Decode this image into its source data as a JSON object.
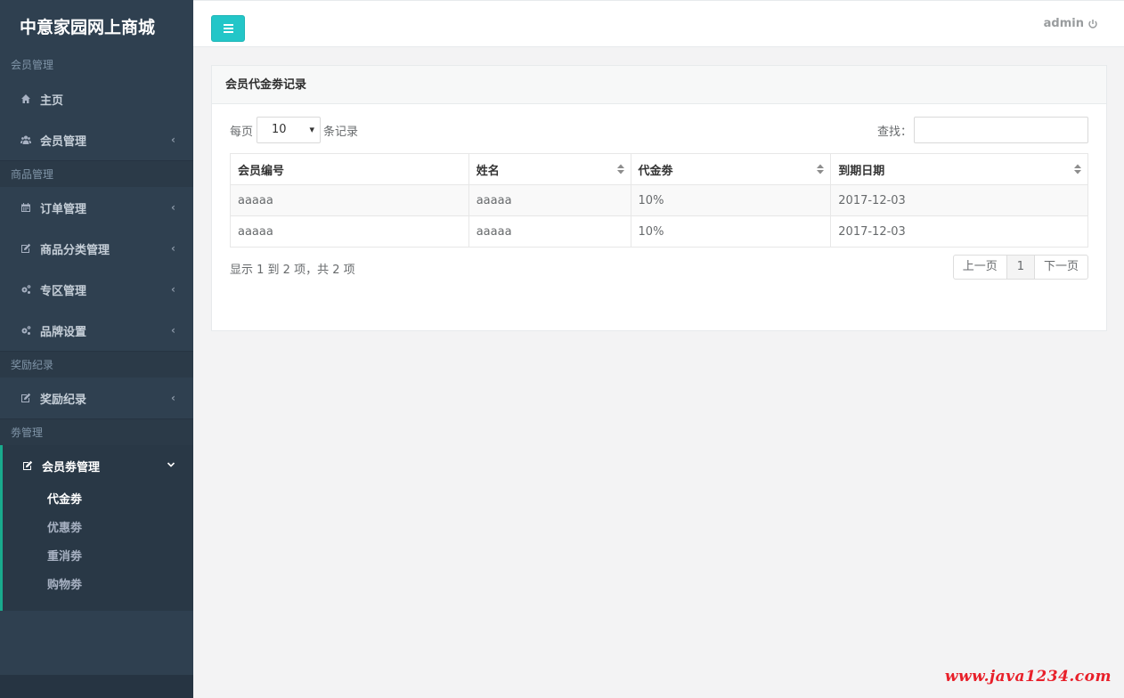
{
  "app": {
    "title": "中意家园网上商城"
  },
  "sidebar": {
    "sections": [
      {
        "label": "会员管理"
      },
      {
        "label": "商品管理"
      },
      {
        "label": "奖励纪录"
      },
      {
        "label": "劵管理"
      }
    ],
    "items": [
      {
        "label": "主页",
        "icon": "home-icon"
      },
      {
        "label": "会员管理",
        "icon": "users-icon"
      },
      {
        "label": "订单管理",
        "icon": "calendar-icon"
      },
      {
        "label": "商品分类管理",
        "icon": "edit-icon"
      },
      {
        "label": "专区管理",
        "icon": "cogs-icon"
      },
      {
        "label": "品牌设置",
        "icon": "cogs-icon"
      },
      {
        "label": "奖励纪录",
        "icon": "edit-icon"
      },
      {
        "label": "会员劵管理",
        "icon": "edit-icon"
      }
    ],
    "subitems": [
      {
        "label": "代金劵",
        "active": true
      },
      {
        "label": "优惠劵"
      },
      {
        "label": "重消劵"
      },
      {
        "label": "购物劵"
      }
    ]
  },
  "header": {
    "user": "admin"
  },
  "panel": {
    "title": "会员代金劵记录",
    "length_label_prefix": "每页",
    "length_value": "10",
    "length_label_suffix": "条记录",
    "search_label": "查找：",
    "search_value": "",
    "columns": [
      "会员编号",
      "姓名",
      "代金劵",
      "到期日期"
    ],
    "rows": [
      [
        "aaaaa",
        "aaaaa",
        "10%",
        "2017-12-03"
      ],
      [
        "aaaaa",
        "aaaaa",
        "10%",
        "2017-12-03"
      ]
    ],
    "info": "显示 1 到 2 项，共 2 项",
    "pager": {
      "prev": "上一页",
      "current": "1",
      "next": "下一页"
    }
  },
  "watermark": "www.java1234.com",
  "colors": {
    "sidebar": "#2f4050",
    "accent": "#23c6c8",
    "active_border": "#19aa8d",
    "watermark": "#e8202a"
  }
}
